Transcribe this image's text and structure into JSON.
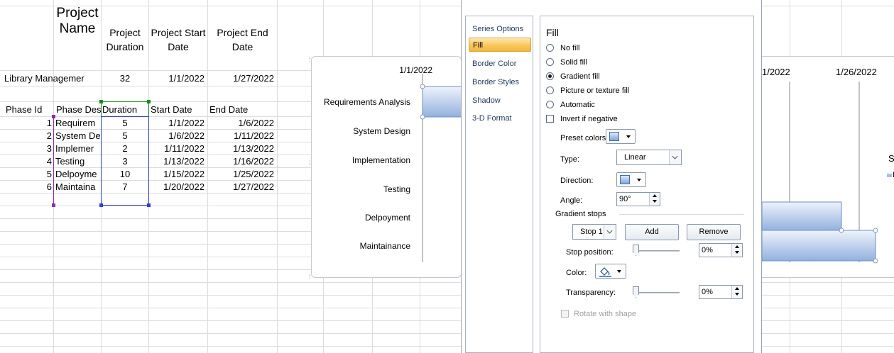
{
  "sheet": {
    "header": {
      "project_name": "Project Name",
      "project_duration": "Project Duration",
      "project_start": "Project Start Date",
      "project_end": "Project End Date"
    },
    "project_row": {
      "name": "Library Managemer",
      "duration": "32",
      "start": "1/1/2022",
      "end": "1/27/2022"
    },
    "phase_header": {
      "phase_id": "Phase Id",
      "phase_desc": "Phase Des",
      "duration": "Duration",
      "start": "Start Date",
      "end": "End Date"
    },
    "phases": [
      {
        "id": "1",
        "desc": "Requirem",
        "duration": "5",
        "start": "1/1/2022",
        "end": "1/6/2022"
      },
      {
        "id": "2",
        "desc": "System De",
        "duration": "5",
        "start": "1/6/2022",
        "end": "1/11/2022"
      },
      {
        "id": "3",
        "desc": "Implemer",
        "duration": "2",
        "start": "1/11/2022",
        "end": "1/13/2022"
      },
      {
        "id": "4",
        "desc": "Testing",
        "duration": "3",
        "start": "1/13/2022",
        "end": "1/16/2022"
      },
      {
        "id": "5",
        "desc": "Delpoyme",
        "duration": "10",
        "start": "1/15/2022",
        "end": "1/25/2022"
      },
      {
        "id": "6",
        "desc": "Maintaina",
        "duration": "7",
        "start": "1/20/2022",
        "end": "1/27/2022"
      }
    ]
  },
  "chart": {
    "axis_date_left": "1/1/2022",
    "axis_date_right_1": "1/2022",
    "axis_date_right_2": "1/26/2022",
    "legend_fragment_1": "S",
    "legend_fragment_2": "D",
    "categories": [
      "Requirements Analysis",
      "System Design",
      "Implementation",
      "Testing",
      "Delpoyment",
      "Maintainance"
    ],
    "bar_color_top": "#eef3fb",
    "bar_color_bottom": "#93b1de"
  },
  "dialog": {
    "nav": [
      "Series Options",
      "Fill",
      "Border Color",
      "Border Styles",
      "Shadow",
      "3-D Format"
    ],
    "active_nav": "Fill",
    "title": "Fill",
    "options": {
      "no_fill": "No fill",
      "solid_fill": "Solid fill",
      "gradient_fill": "Gradient fill",
      "picture_fill": "Picture or texture fill",
      "automatic": "Automatic",
      "invert": "Invert if negative"
    },
    "selected_option": "Gradient fill",
    "preset_colors_label": "Preset colors:",
    "type_label": "Type:",
    "type_value": "Linear",
    "direction_label": "Direction:",
    "angle_label": "Angle:",
    "angle_value": "90°",
    "gradient_stops_label": "Gradient stops",
    "stop_value": "Stop 1",
    "add_label": "Add",
    "remove_label": "Remove",
    "stop_position_label": "Stop position:",
    "stop_position_value": "0%",
    "color_label": "Color:",
    "transparency_label": "Transparency:",
    "transparency_value": "0%",
    "rotate_label": "Rotate with shape",
    "accent_active": "#f9c962"
  }
}
